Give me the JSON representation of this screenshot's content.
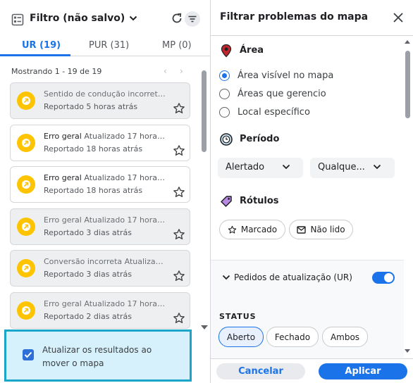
{
  "left": {
    "filter_title": "Filtro (não salvo)",
    "tabs": [
      {
        "label": "UR (19)",
        "active": true
      },
      {
        "label": "PUR (31)",
        "active": false
      },
      {
        "label": "MP (0)",
        "active": false
      }
    ],
    "showing": "Mostrando 1 - 19 de 19",
    "cards": [
      {
        "title": "Sentido de condução incorreto ...",
        "updated": "",
        "reported": "Reportado 5 horas atrás",
        "dim": true
      },
      {
        "title": "Erro geral",
        "updated": "Atualizado 17 horas a...",
        "reported": "Reportado 18 horas atrás",
        "dim": false
      },
      {
        "title": "Erro geral",
        "updated": "Atualizado 17 horas a...",
        "reported": "Reportado 18 horas atrás",
        "dim": false
      },
      {
        "title": "Erro geral",
        "updated": "Atualizado 17 horas a...",
        "reported": "Reportado 3 dias atrás",
        "dim": true
      },
      {
        "title": "Conversão incorreta",
        "updated": "Atualizado...",
        "reported": "Reportado 3 dias atrás",
        "dim": true
      },
      {
        "title": "Erro geral",
        "updated": "Atualizado 17 horas a...",
        "reported": "Reportado 2 dias atrás",
        "dim": true
      }
    ],
    "update_results": {
      "label": "Atualizar os resultados ao mover o mapa",
      "checked": true
    }
  },
  "right": {
    "title": "Filtrar problemas do mapa",
    "area": {
      "label": "Área",
      "options": [
        {
          "label": "Área visível no mapa",
          "selected": true
        },
        {
          "label": "Áreas que gerencio",
          "selected": false
        },
        {
          "label": "Local específico",
          "selected": false
        }
      ]
    },
    "periodo": {
      "label": "Período",
      "dropdown1": "Alertado",
      "dropdown2": "Qualque..."
    },
    "rotulos": {
      "label": "Rótulos",
      "chip1": "Marcado",
      "chip2": "Não lido"
    },
    "pedidos": {
      "label": "Pedidos de atualização (UR)",
      "enabled": true
    },
    "status": {
      "label": "STATUS",
      "options": [
        {
          "label": "Aberto",
          "selected": true
        },
        {
          "label": "Fechado",
          "selected": false
        },
        {
          "label": "Ambos",
          "selected": false
        }
      ]
    },
    "cancel_label": "Cancelar",
    "apply_label": "Aplicar"
  },
  "colors": {
    "accent": "#1a73e8",
    "badge": "#ffc400",
    "highlight_bg": "#d6f1fb",
    "highlight_border": "#1aa6c8"
  }
}
